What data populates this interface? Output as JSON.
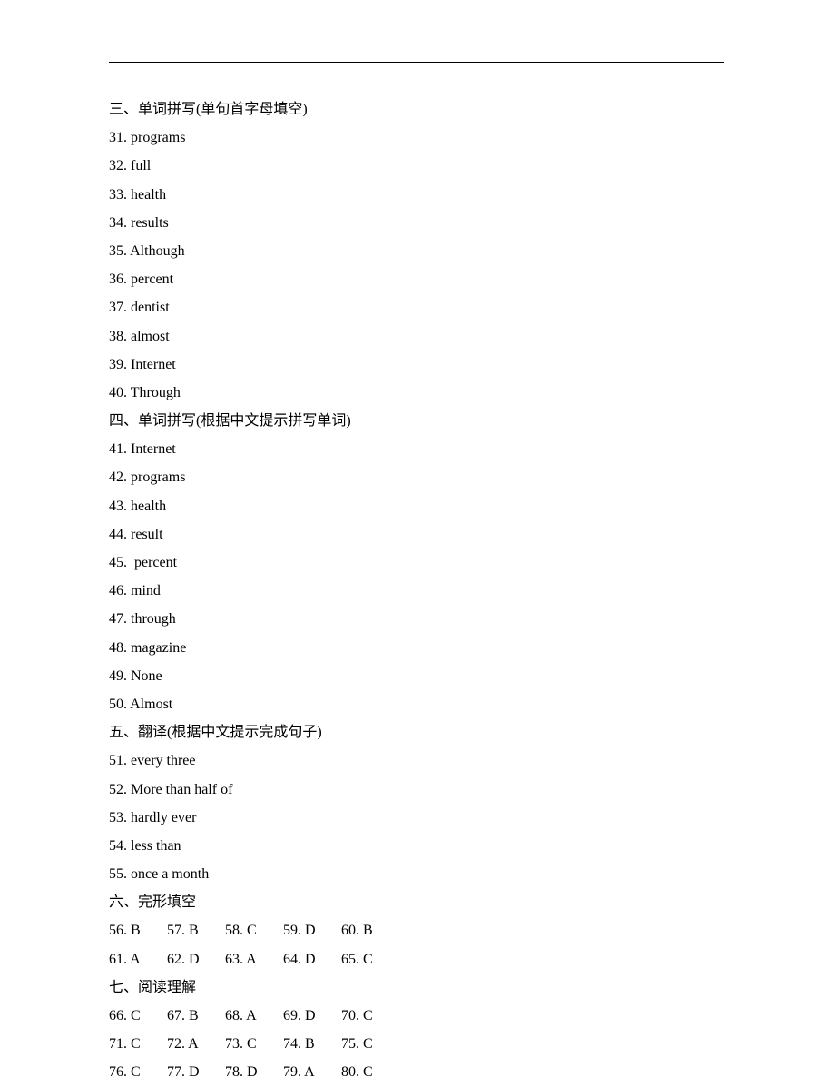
{
  "sections": {
    "s3": {
      "heading": "三、单词拼写(单句首字母填空)",
      "items": [
        {
          "num": "31",
          "text": "programs"
        },
        {
          "num": "32",
          "text": "full"
        },
        {
          "num": "33",
          "text": "health"
        },
        {
          "num": "34",
          "text": "results"
        },
        {
          "num": "35",
          "text": "Although"
        },
        {
          "num": "36",
          "text": "percent"
        },
        {
          "num": "37",
          "text": "dentist"
        },
        {
          "num": "38",
          "text": "almost"
        },
        {
          "num": "39",
          "text": "Internet"
        },
        {
          "num": "40",
          "text": "Through"
        }
      ]
    },
    "s4": {
      "heading": "四、单词拼写(根据中文提示拼写单词)",
      "items": [
        {
          "num": "41",
          "text": "Internet"
        },
        {
          "num": "42",
          "text": "programs"
        },
        {
          "num": "43",
          "text": "health"
        },
        {
          "num": "44",
          "text": "result"
        },
        {
          "num": "45",
          "text": " percent"
        },
        {
          "num": "46",
          "text": "mind"
        },
        {
          "num": "47",
          "text": "through"
        },
        {
          "num": "48",
          "text": "magazine"
        },
        {
          "num": "49",
          "text": "None"
        },
        {
          "num": "50",
          "text": "Almost"
        }
      ]
    },
    "s5": {
      "heading": "五、翻译(根据中文提示完成句子)",
      "items": [
        {
          "num": "51",
          "text": "every three"
        },
        {
          "num": "52",
          "text": "More than half of"
        },
        {
          "num": "53",
          "text": "hardly ever"
        },
        {
          "num": "54",
          "text": "less than"
        },
        {
          "num": "55",
          "text": "once a month"
        }
      ]
    },
    "s6": {
      "heading": "六、完形填空",
      "rows": [
        [
          {
            "num": "56",
            "ans": "B"
          },
          {
            "num": "57",
            "ans": "B"
          },
          {
            "num": "58",
            "ans": "C"
          },
          {
            "num": "59",
            "ans": "D"
          },
          {
            "num": "60",
            "ans": "B"
          }
        ],
        [
          {
            "num": "61",
            "ans": "A"
          },
          {
            "num": "62",
            "ans": "D"
          },
          {
            "num": "63",
            "ans": "A"
          },
          {
            "num": "64",
            "ans": "D"
          },
          {
            "num": "65",
            "ans": "C"
          }
        ]
      ]
    },
    "s7": {
      "heading": "七、阅读理解",
      "rows": [
        [
          {
            "num": "66",
            "ans": "C"
          },
          {
            "num": "67",
            "ans": "B"
          },
          {
            "num": "68",
            "ans": "A"
          },
          {
            "num": "69",
            "ans": "D"
          },
          {
            "num": "70",
            "ans": "C"
          }
        ],
        [
          {
            "num": "71",
            "ans": "C"
          },
          {
            "num": "72",
            "ans": "A"
          },
          {
            "num": "73",
            "ans": "C"
          },
          {
            "num": "74",
            "ans": "B"
          },
          {
            "num": "75",
            "ans": "C"
          }
        ],
        [
          {
            "num": "76",
            "ans": "C"
          },
          {
            "num": "77",
            "ans": "D"
          },
          {
            "num": "78",
            "ans": "D"
          },
          {
            "num": "79",
            "ans": "A"
          },
          {
            "num": "80",
            "ans": "C"
          }
        ]
      ]
    }
  }
}
